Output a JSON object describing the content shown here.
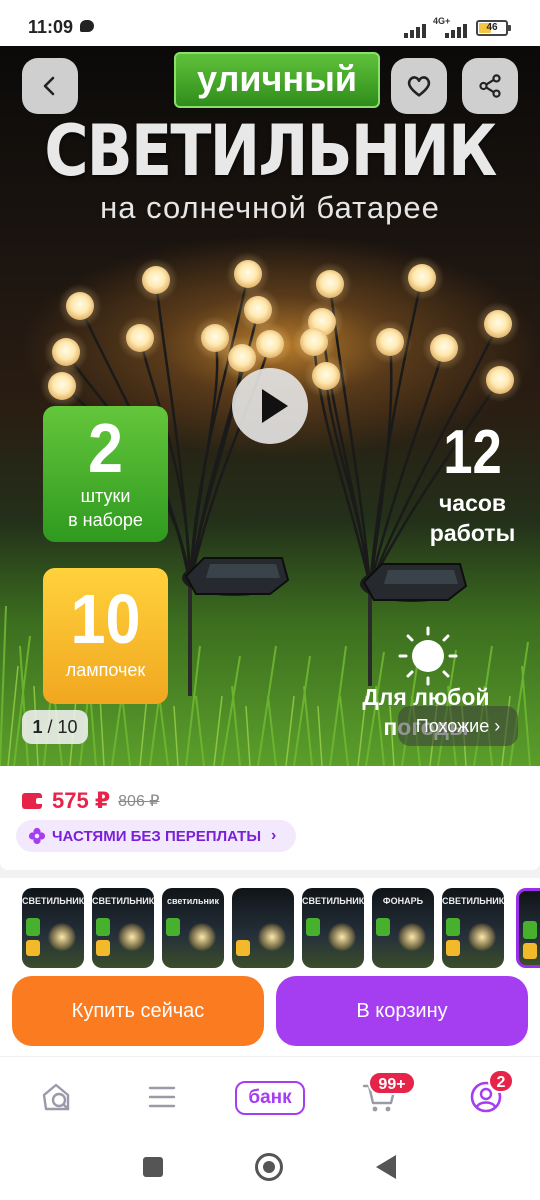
{
  "status_bar": {
    "time": "11:09",
    "network": "4G+",
    "battery": "46",
    "battery_level_percent": 46
  },
  "hero": {
    "top_label": "уличный",
    "title": "СВЕТИЛЬНИК",
    "subtitle": "на солнечной батарее",
    "badge_count": {
      "number": "2",
      "line1": "штуки",
      "line2": "в наборе"
    },
    "badge_lamps": {
      "number": "10",
      "line1": "лампочек"
    },
    "hours": {
      "number": "12",
      "line1": "часов",
      "line2": "работы"
    },
    "weather": {
      "line1": "Для любой",
      "line2": "погоды"
    },
    "counter": {
      "current": "1",
      "total": "10"
    },
    "similar_label": "Похожие ›",
    "icons": {
      "back": "back-arrow-icon",
      "favorite": "heart-icon",
      "share": "share-icon",
      "play": "play-icon"
    }
  },
  "pricing": {
    "price": "575 ₽",
    "old_price": "806 ₽",
    "installments": "ЧАСТЯМИ БЕЗ ПЕРЕПЛАТЫ",
    "accent_color": "#e6244a",
    "installments_color": "#7a20d6"
  },
  "thumbnails": [
    {
      "label": "СВЕТИЛЬНИК"
    },
    {
      "label": "СВЕТИЛЬНИК"
    },
    {
      "label": "светильник"
    },
    {
      "label": ""
    },
    {
      "label": "СВЕТИЛЬНИК"
    },
    {
      "label": "ФОНАРЬ"
    },
    {
      "label": "СВЕТИЛЬНИК"
    },
    {
      "label": ""
    }
  ],
  "actions": {
    "buy_now": "Купить сейчас",
    "add_to_cart": "В корзину",
    "buy_color": "#fb7b21",
    "cart_color": "#a53ef0"
  },
  "bottom_nav": {
    "bank_label": "банк",
    "cart_badge": "99+",
    "profile_badge": "2",
    "icons": [
      "home-search-icon",
      "catalog-menu-icon",
      "bank-icon",
      "cart-icon",
      "profile-icon"
    ]
  }
}
